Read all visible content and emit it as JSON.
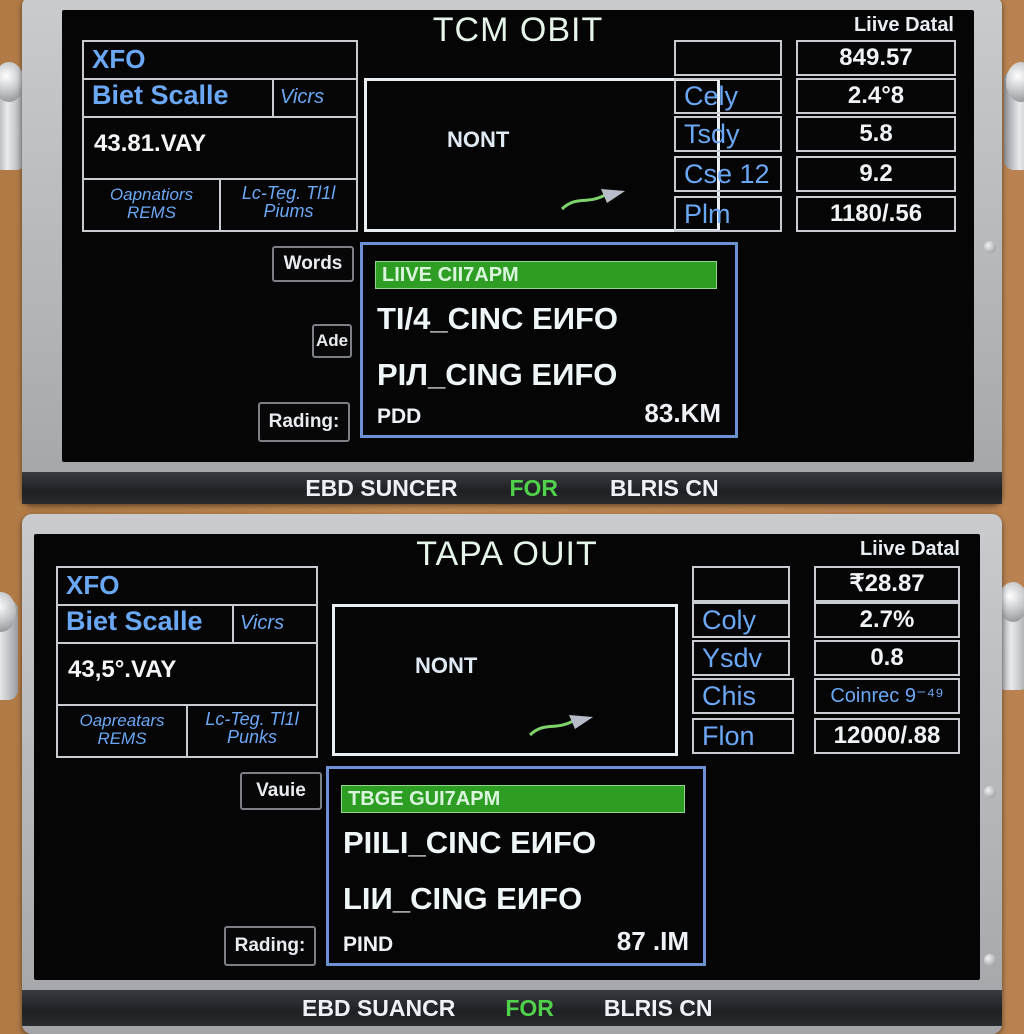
{
  "panels": [
    {
      "title": "TCM OBIT",
      "live_data_title": "Liive Datal",
      "info": {
        "header": "XFO",
        "scale_label": "Biet Scalle",
        "scale_unit": "Vicrs",
        "reading": "43.81.VAY",
        "bottom_left": [
          "Oapnatiors",
          "REMS"
        ],
        "bottom_right": [
          "Lc-Teg. Tl1l",
          "Piums"
        ]
      },
      "nav": {
        "label": "NONT",
        "arrow_icon": "arrow-icon"
      },
      "side_buttons": [
        "Words",
        "Ade",
        "Rading:"
      ],
      "list": {
        "highlight": "LIIVE CII7APM",
        "items": [
          "TI/4_CINC EИFO",
          "PIЛ_CING EИFO"
        ],
        "footer_left": "PDD",
        "footer_right": "83.KM"
      },
      "live_data": [
        {
          "label": "",
          "value": "849.57"
        },
        {
          "label": "Cely",
          "value": "2.4°8"
        },
        {
          "label": "Tsdy",
          "value": "5.8"
        },
        {
          "label": "Cse 12",
          "value": "9.2"
        },
        {
          "label": "Plm",
          "value": "1180/.56"
        }
      ],
      "footer": {
        "left": "EBD SUNCER",
        "middle": "FOR",
        "right": "BLRIS CN"
      }
    },
    {
      "title": "TAPA OUIT",
      "live_data_title": "Liive Datal",
      "info": {
        "header": "XFO",
        "scale_label": "Biet Scalle",
        "scale_unit": "Vicrs",
        "reading": "43,5°.VAY",
        "bottom_left": [
          "Oapreatars",
          "REMS"
        ],
        "bottom_right": [
          "Lc-Teg. Tl1l",
          "Punks"
        ]
      },
      "nav": {
        "label": "NONT",
        "arrow_icon": "arrow-icon"
      },
      "side_buttons": [
        "Vauie",
        "Rading:"
      ],
      "list": {
        "highlight": "TBGE GUI7APM",
        "items": [
          "PIILI_CINC EИFO",
          "LIИ_CING EИFO"
        ],
        "footer_left": "PIND",
        "footer_right": "87 .IM"
      },
      "live_data": [
        {
          "label": "",
          "value": "₹28.87"
        },
        {
          "label": "Coly",
          "value": "2.7%"
        },
        {
          "label": "Ysdv",
          "value": "0.8"
        },
        {
          "label": "Chis",
          "value": "Coinrec 9⁻⁴⁹"
        },
        {
          "label": "Flon",
          "value": "12000/.88"
        }
      ],
      "footer": {
        "left": "EBD SUANCR",
        "middle": "FOR",
        "right": "BLRIS CN"
      }
    }
  ],
  "colors": {
    "accent_green": "#2e9d24",
    "label_blue": "#6aa8f5",
    "footer_green": "#4fd14a",
    "list_border_blue": "#6d8fd4"
  }
}
